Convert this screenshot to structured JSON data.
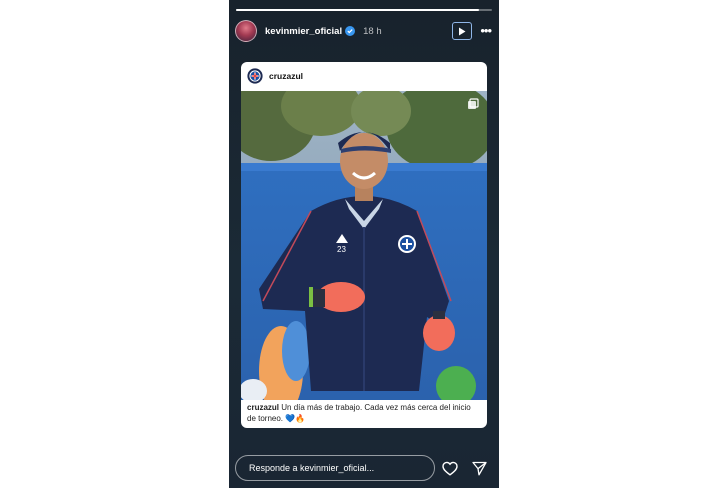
{
  "story": {
    "progress": 0.95,
    "username": "kevinmier_oficial",
    "time_ago": "18 h",
    "more_label": "•••"
  },
  "card": {
    "username": "cruzazul",
    "caption_user": "cruzazul",
    "caption_text": "Un día más de trabajo. Cada vez más cerca del inicio de torneo.",
    "caption_emojis": "💙🔥",
    "jersey_number": "23"
  },
  "footer": {
    "reply_placeholder": "Responde a kevinmier_oficial..."
  },
  "colors": {
    "story_bg": "#1b2a36",
    "jersey": "#1d2a52",
    "gloves": "#f26d5b",
    "verified": "#3897f0"
  },
  "icons": [
    "verified-icon",
    "play-icon",
    "more-icon",
    "cruz-azul-logo",
    "multi-image-icon",
    "heart-icon",
    "send-icon"
  ]
}
